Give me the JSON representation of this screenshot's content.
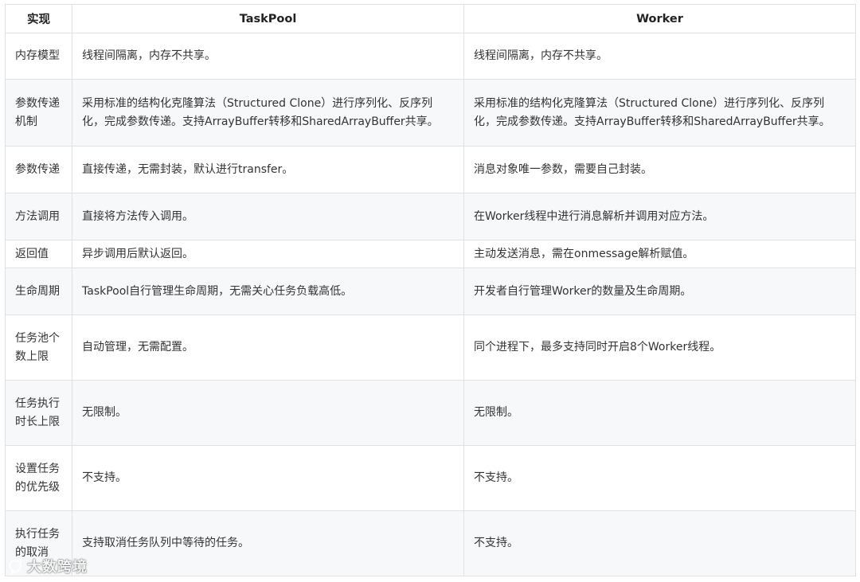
{
  "table": {
    "headers": [
      "实现",
      "TaskPool",
      "Worker"
    ],
    "rows": [
      {
        "feature": "内存模型",
        "taskpool": "线程间隔离，内存不共享。",
        "worker": "线程间隔离，内存不共享。"
      },
      {
        "feature": "参数传递机制",
        "taskpool": "采用标准的结构化克隆算法（Structured Clone）进行序列化、反序列化，完成参数传递。支持ArrayBuffer转移和SharedArrayBuffer共享。",
        "worker": "采用标准的结构化克隆算法（Structured Clone）进行序列化、反序列化，完成参数传递。支持ArrayBuffer转移和SharedArrayBuffer共享。"
      },
      {
        "feature": "参数传递",
        "taskpool": "直接传递，无需封装，默认进行transfer。",
        "worker": "消息对象唯一参数，需要自己封装。"
      },
      {
        "feature": "方法调用",
        "taskpool": "直接将方法传入调用。",
        "worker": "在Worker线程中进行消息解析并调用对应方法。"
      },
      {
        "feature": "返回值",
        "taskpool": "异步调用后默认返回。",
        "worker": "主动发送消息，需在onmessage解析赋值。"
      },
      {
        "feature": "生命周期",
        "taskpool": "TaskPool自行管理生命周期，无需关心任务负载高低。",
        "worker": "开发者自行管理Worker的数量及生命周期。"
      },
      {
        "feature": "任务池个数上限",
        "taskpool": "自动管理，无需配置。",
        "worker": "同个进程下，最多支持同时开启8个Worker线程。"
      },
      {
        "feature": "任务执行时长上限",
        "taskpool": "无限制。",
        "worker": "无限制。"
      },
      {
        "feature": "设置任务的优先级",
        "taskpool": "不支持。",
        "worker": "不支持。"
      },
      {
        "feature": "执行任务的取消",
        "taskpool": "支持取消任务队列中等待的任务。",
        "worker": "不支持。"
      }
    ]
  },
  "watermark": {
    "text": "大数跨境",
    "icon": "watermark-logo-icon"
  }
}
